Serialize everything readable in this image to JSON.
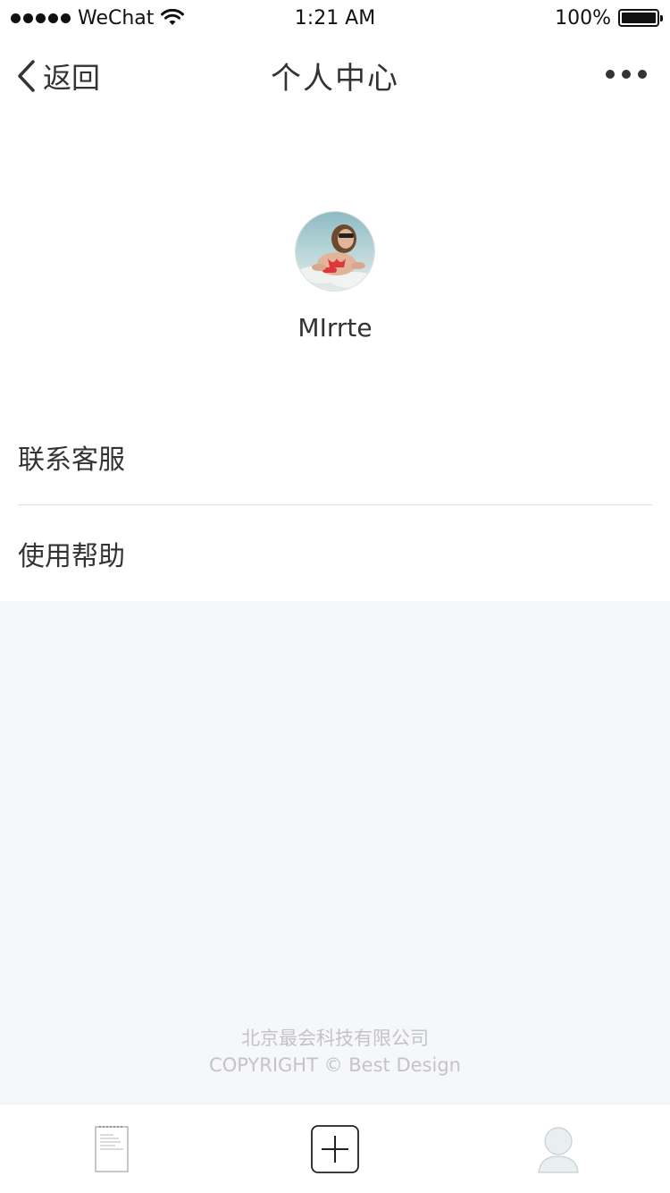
{
  "status_bar": {
    "carrier": "WeChat",
    "time": "1:21 AM",
    "battery": "100%"
  },
  "nav": {
    "back_label": "返回",
    "title": "个人中心"
  },
  "profile": {
    "username": "MIrrte"
  },
  "menu": {
    "items": [
      {
        "label": "联系客服"
      },
      {
        "label": "使用帮助"
      }
    ]
  },
  "footer": {
    "company": "北京最会科技有限公司",
    "copyright": "COPYRIGHT © Best Design"
  },
  "tabs": [
    {
      "icon": "document-icon"
    },
    {
      "icon": "add-icon"
    },
    {
      "icon": "user-icon"
    }
  ]
}
